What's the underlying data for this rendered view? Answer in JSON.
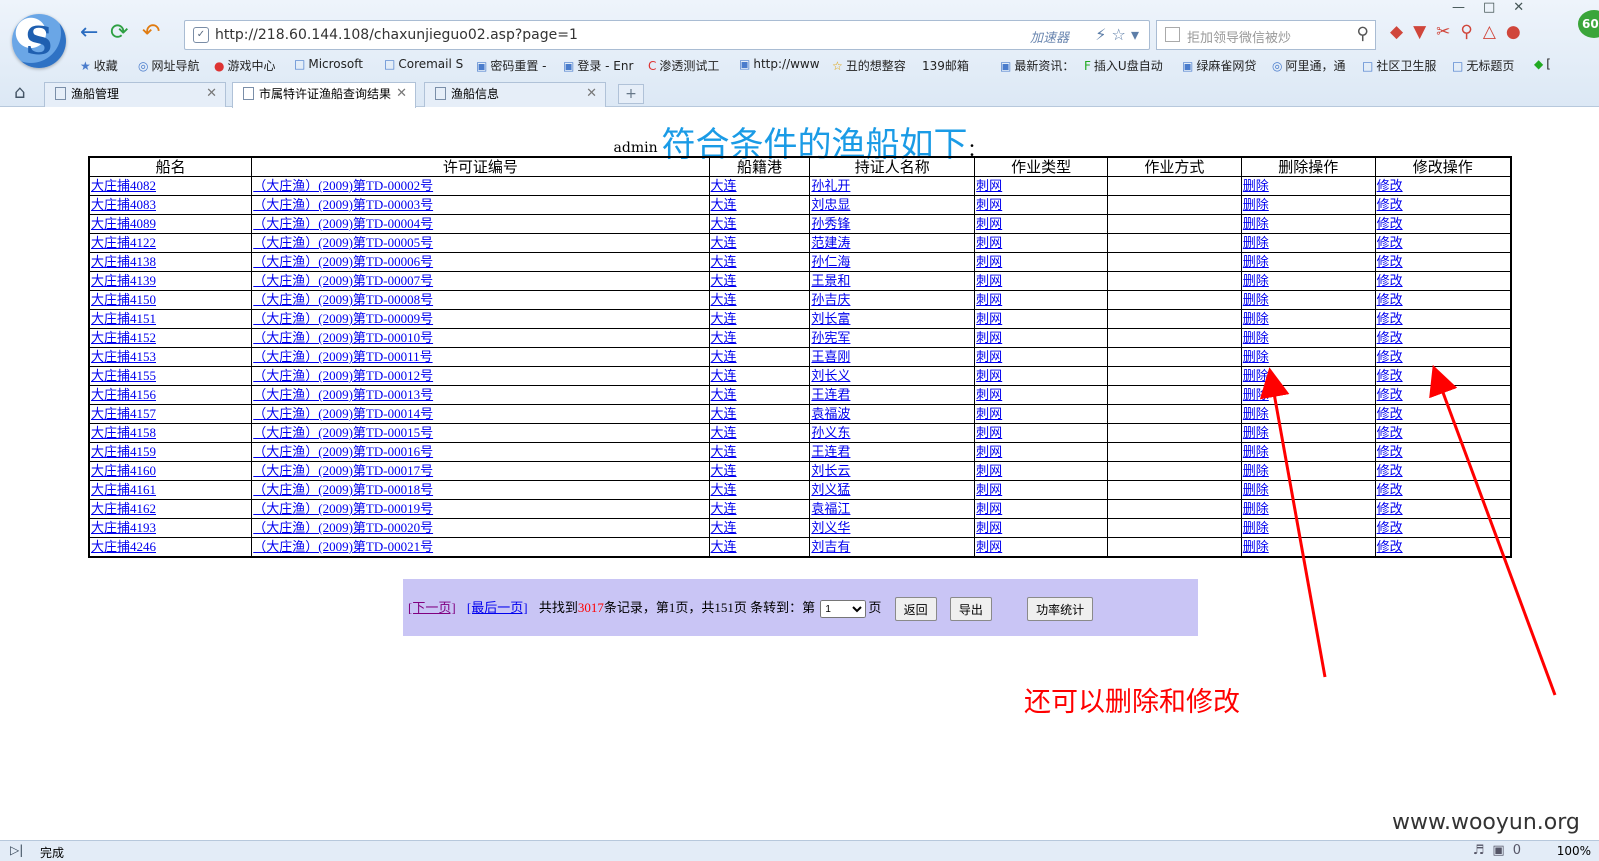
{
  "browser": {
    "url": "http://218.60.144.108/chaxunjieguo02.asp?page=1",
    "accelerator": "加速器",
    "search_placeholder": "拒加领导微信被炒",
    "badge": "60",
    "bookmarks": [
      "收藏",
      "网址导航",
      "游戏中心",
      "Microsoft",
      "Coremail S",
      "密码重置 -",
      "登录 - Enr",
      "渗透测试工",
      "http://www",
      "丑的想整容",
      "139邮箱",
      "最新资讯：",
      "插入U盘自动",
      "绿麻雀网贷",
      "阿里通，通",
      "社区卫生服",
      "无标题页",
      "["
    ],
    "tabs": [
      {
        "label": "渔船管理",
        "active": false
      },
      {
        "label": "市属特许证渔船查询结果",
        "active": true
      },
      {
        "label": "渔船信息",
        "active": false
      }
    ]
  },
  "heading": {
    "user": "admin",
    "title": "符合条件的渔船如下",
    "colon": "："
  },
  "table": {
    "columns": [
      "船名",
      "许可证编号",
      "船籍港",
      "持证人名称",
      "作业类型",
      "作业方式",
      "删除操作",
      "修改操作"
    ],
    "rows": [
      [
        "大庄捕4082",
        "（大庄渔）(2009)第TD-00002号",
        "大连",
        "孙礼开",
        "刺网",
        "",
        "删除",
        "修改"
      ],
      [
        "大庄捕4083",
        "（大庄渔）(2009)第TD-00003号",
        "大连",
        "刘忠显",
        "刺网",
        "",
        "删除",
        "修改"
      ],
      [
        "大庄捕4089",
        "（大庄渔）(2009)第TD-00004号",
        "大连",
        "孙秀锋",
        "刺网",
        "",
        "删除",
        "修改"
      ],
      [
        "大庄捕4122",
        "（大庄渔）(2009)第TD-00005号",
        "大连",
        "范建涛",
        "刺网",
        "",
        "删除",
        "修改"
      ],
      [
        "大庄捕4138",
        "（大庄渔）(2009)第TD-00006号",
        "大连",
        "孙仁海",
        "刺网",
        "",
        "删除",
        "修改"
      ],
      [
        "大庄捕4139",
        "（大庄渔）(2009)第TD-00007号",
        "大连",
        "王景和",
        "刺网",
        "",
        "删除",
        "修改"
      ],
      [
        "大庄捕4150",
        "（大庄渔）(2009)第TD-00008号",
        "大连",
        "孙吉庆",
        "刺网",
        "",
        "删除",
        "修改"
      ],
      [
        "大庄捕4151",
        "（大庄渔）(2009)第TD-00009号",
        "大连",
        "刘长富",
        "刺网",
        "",
        "删除",
        "修改"
      ],
      [
        "大庄捕4152",
        "（大庄渔）(2009)第TD-00010号",
        "大连",
        "孙宪军",
        "刺网",
        "",
        "删除",
        "修改"
      ],
      [
        "大庄捕4153",
        "（大庄渔）(2009)第TD-00011号",
        "大连",
        "王喜刚",
        "刺网",
        "",
        "删除",
        "修改"
      ],
      [
        "大庄捕4155",
        "（大庄渔）(2009)第TD-00012号",
        "大连",
        "刘长义",
        "刺网",
        "",
        "删除",
        "修改"
      ],
      [
        "大庄捕4156",
        "（大庄渔）(2009)第TD-00013号",
        "大连",
        "王连君",
        "刺网",
        "",
        "删除",
        "修改"
      ],
      [
        "大庄捕4157",
        "（大庄渔）(2009)第TD-00014号",
        "大连",
        "袁福波",
        "刺网",
        "",
        "删除",
        "修改"
      ],
      [
        "大庄捕4158",
        "（大庄渔）(2009)第TD-00015号",
        "大连",
        "孙义东",
        "刺网",
        "",
        "删除",
        "修改"
      ],
      [
        "大庄捕4159",
        "（大庄渔）(2009)第TD-00016号",
        "大连",
        "王连君",
        "刺网",
        "",
        "删除",
        "修改"
      ],
      [
        "大庄捕4160",
        "（大庄渔）(2009)第TD-00017号",
        "大连",
        "刘长云",
        "刺网",
        "",
        "删除",
        "修改"
      ],
      [
        "大庄捕4161",
        "（大庄渔）(2009)第TD-00018号",
        "大连",
        "刘义猛",
        "刺网",
        "",
        "删除",
        "修改"
      ],
      [
        "大庄捕4162",
        "（大庄渔）(2009)第TD-00019号",
        "大连",
        "袁福江",
        "刺网",
        "",
        "删除",
        "修改"
      ],
      [
        "大庄捕4193",
        "（大庄渔）(2009)第TD-00020号",
        "大连",
        "刘义华",
        "刺网",
        "",
        "删除",
        "修改"
      ],
      [
        "大庄捕4246",
        "（大庄渔）(2009)第TD-00021号",
        "大连",
        "刘吉有",
        "刺网",
        "",
        "删除",
        "修改"
      ]
    ]
  },
  "pager": {
    "next": "[下一页]",
    "last": "[最后一页]",
    "found_prefix": "共找到",
    "count": "3017",
    "found_suffix": "条记录，第1页，共151页 条转到：第",
    "page_select": "1",
    "page_unit": "页",
    "back": "返回",
    "export": "导出",
    "stats": "功率统计"
  },
  "annotation": {
    "note": "还可以删除和修改",
    "color": "#ff0000"
  },
  "watermark": "www.wooyun.org",
  "status": {
    "text": "完成",
    "zoom": "100%",
    "counter": "0"
  }
}
